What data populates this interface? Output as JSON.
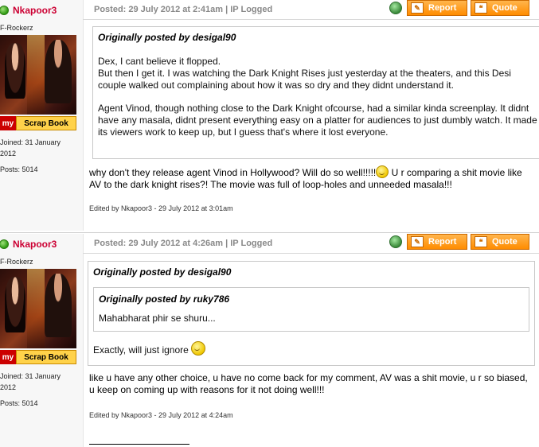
{
  "posts": [
    {
      "username": "Nkapoor3",
      "rank": "F-Rockerz",
      "scrapbook_my": "my",
      "scrapbook_label": "Scrap Book",
      "joined": "Joined: 31 January 2012",
      "posts": "Posts: 5014",
      "posted": "Posted: 29 July 2012 at 2:41am | IP Logged",
      "report_label": "Report",
      "quote_label": "Quote",
      "quote": {
        "author": "Originally posted by desigal90",
        "p1": "Dex, I cant believe it flopped.",
        "p2": "But then I get it. I was watching the Dark Knight Rises just yesterday at the theaters, and this Desi couple walked out complaining about how it was so dry and they didnt understand it.",
        "p3": "Agent Vinod, though nothing close to the Dark Knight ofcourse, had a similar kinda screenplay. It didnt have any masala, didnt present everything easy on a platter for audiences to just dumbly watch. It made its viewers work to keep up, but I guess that's where it lost everyone."
      },
      "message_before": "why don't they release agent Vinod in Hollywood? Will do so well!!!!!",
      "message_after": " U r comparing a shit movie like AV to the dark knight rises?! The movie was full of loop-holes and unneeded masala!!!",
      "edited": "Edited by Nkapoor3 - 29 July 2012 at 3:01am"
    },
    {
      "username": "Nkapoor3",
      "rank": "F-Rockerz",
      "scrapbook_my": "my",
      "scrapbook_label": "Scrap Book",
      "joined": "Joined: 31 January 2012",
      "posts": "Posts: 5014",
      "posted": "Posted: 29 July 2012 at 4:26am | IP Logged",
      "report_label": "Report",
      "quote_label": "Quote",
      "quote": {
        "author": "Originally posted by desigal90",
        "nested_author": "Originally posted by ruky786",
        "nested_body": "Mahabharat phir se shuru...",
        "body": "Exactly, will just ignore "
      },
      "message": "like u have any other choice, u have no come back for my comment, AV was a shit movie, u r so biased, u keep on coming up with reasons for it not doing well!!!",
      "edited": "Edited by Nkapoor3 - 29 July 2012 at 4:24am"
    }
  ],
  "icons": {
    "online": "online-status-icon",
    "pm": "private-message-icon",
    "report": "report-icon",
    "quote": "quote-icon",
    "smiley": "smiley-icon"
  },
  "colors": {
    "username": "#cc0033",
    "button": "#ff8c00",
    "sidebar_bg": "#f7f7f7"
  }
}
